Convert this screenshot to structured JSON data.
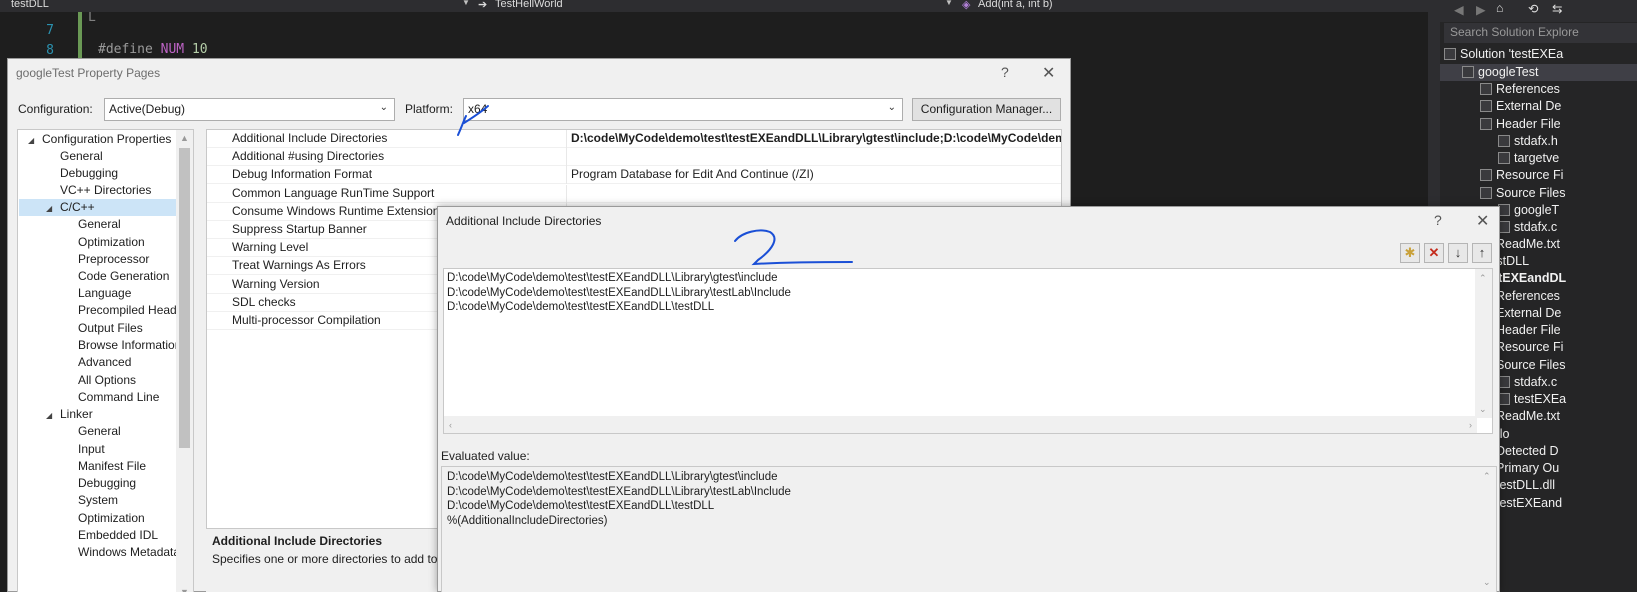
{
  "navbar": {
    "project": "testDLL",
    "scope": "TestHellWorld",
    "member": "Add(int a, int b)"
  },
  "code": {
    "lines": [
      {
        "num": "7",
        "text": "L"
      },
      {
        "num": "8",
        "directive": "#define",
        "macro": "NUM",
        "value": "10"
      }
    ]
  },
  "solution_explorer": {
    "search_placeholder": "Search Solution Explore",
    "items": [
      "Solution 'testEXEa",
      "googleTest",
      "References",
      "External De",
      "Header File",
      "stdafx.h",
      "targetve",
      "Resource Fi",
      "Source Files",
      "googleT",
      "stdafx.c",
      "ReadMe.txt",
      "testDLL",
      "testEXEandDL",
      "References",
      "External De",
      "Header File",
      "Resource Fi",
      "Source Files",
      "stdafx.c",
      "testEXEa",
      "ReadMe.txt",
      "ello",
      "Detected D",
      "Primary Ou",
      "testDLL.dll",
      "testEXEand"
    ]
  },
  "property_pages": {
    "title": "googleTest Property Pages",
    "help": "?",
    "close": "✕",
    "configuration_label": "Configuration:",
    "configuration_value": "Active(Debug)",
    "platform_label": "Platform:",
    "platform_value": "x64",
    "config_manager_button": "Configuration Manager...",
    "tree": [
      {
        "label": "Configuration Properties",
        "level": 0,
        "expander": "◢"
      },
      {
        "label": "General",
        "level": 1
      },
      {
        "label": "Debugging",
        "level": 1
      },
      {
        "label": "VC++ Directories",
        "level": 1
      },
      {
        "label": "C/C++",
        "level": 1,
        "expander": "◢",
        "selected": true
      },
      {
        "label": "General",
        "level": 2
      },
      {
        "label": "Optimization",
        "level": 2
      },
      {
        "label": "Preprocessor",
        "level": 2
      },
      {
        "label": "Code Generation",
        "level": 2
      },
      {
        "label": "Language",
        "level": 2
      },
      {
        "label": "Precompiled Heade",
        "level": 2
      },
      {
        "label": "Output Files",
        "level": 2
      },
      {
        "label": "Browse Information",
        "level": 2
      },
      {
        "label": "Advanced",
        "level": 2
      },
      {
        "label": "All Options",
        "level": 2
      },
      {
        "label": "Command Line",
        "level": 2
      },
      {
        "label": "Linker",
        "level": 1,
        "expander": "◢"
      },
      {
        "label": "General",
        "level": 2
      },
      {
        "label": "Input",
        "level": 2
      },
      {
        "label": "Manifest File",
        "level": 2
      },
      {
        "label": "Debugging",
        "level": 2
      },
      {
        "label": "System",
        "level": 2
      },
      {
        "label": "Optimization",
        "level": 2
      },
      {
        "label": "Embedded IDL",
        "level": 2
      },
      {
        "label": "Windows Metadata",
        "level": 2
      }
    ],
    "properties": [
      {
        "name": "Additional Include Directories",
        "value": "D:\\code\\MyCode\\demo\\test\\testEXEandDLL\\Library\\gtest\\include;D:\\code\\MyCode\\demo\\t",
        "bold": true
      },
      {
        "name": "Additional #using Directories",
        "value": ""
      },
      {
        "name": "Debug Information Format",
        "value": "Program Database for Edit And Continue (/ZI)"
      },
      {
        "name": "Common Language RunTime Support",
        "value": ""
      },
      {
        "name": "Consume Windows Runtime Extension",
        "value": ""
      },
      {
        "name": "Suppress Startup Banner",
        "value": ""
      },
      {
        "name": "Warning Level",
        "value": ""
      },
      {
        "name": "Treat Warnings As Errors",
        "value": ""
      },
      {
        "name": "Warning Version",
        "value": ""
      },
      {
        "name": "SDL checks",
        "value": ""
      },
      {
        "name": "Multi-processor Compilation",
        "value": ""
      }
    ],
    "description_title": "Additional Include Directories",
    "description_text": "Specifies one or more directories to add to th"
  },
  "include_dialog": {
    "title": "Additional Include Directories",
    "help": "?",
    "close": "✕",
    "entries": [
      "D:\\code\\MyCode\\demo\\test\\testEXEandDLL\\Library\\gtest\\include",
      "D:\\code\\MyCode\\demo\\test\\testEXEandDLL\\Library\\testLab\\Include",
      "D:\\code\\MyCode\\demo\\test\\testEXEandDLL\\testDLL"
    ],
    "evaluated_label": "Evaluated value:",
    "evaluated": [
      "D:\\code\\MyCode\\demo\\test\\testEXEandDLL\\Library\\gtest\\include",
      "D:\\code\\MyCode\\demo\\test\\testEXEandDLL\\Library\\testLab\\Include",
      "D:\\code\\MyCode\\demo\\test\\testEXEandDLL\\testDLL",
      "%(AdditionalIncludeDirectories)"
    ]
  },
  "annotations": {
    "mark_1_color": "#1a4fd6",
    "mark_2_color": "#1a4fd6"
  }
}
